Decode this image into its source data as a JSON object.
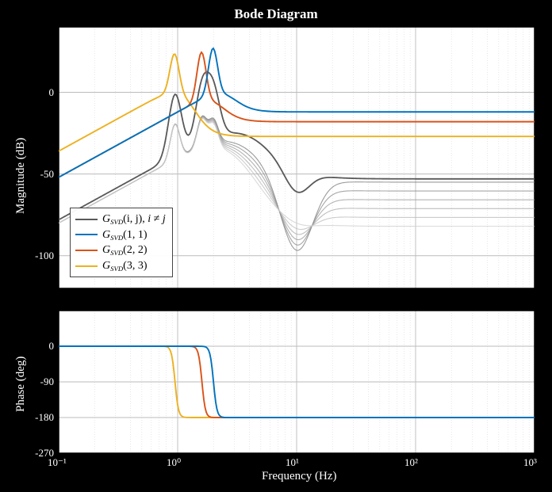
{
  "title": "Bode Diagram",
  "xlabel": "Frequency (Hz)",
  "ylabel_top": "Magnitude (dB)",
  "ylabel_bot": "Phase (deg)",
  "legend": {
    "items": [
      {
        "label_html": "G<sub>SVD</sub>(i, j), i ≠ j",
        "color": "#595959"
      },
      {
        "label_html": "G<sub>SVD</sub>(1, 1)",
        "color": "#0072BD"
      },
      {
        "label_html": "G<sub>SVD</sub>(2, 2)",
        "color": "#D95319"
      },
      {
        "label_html": "G<sub>SVD</sub>(3, 3)",
        "color": "#EDB120"
      }
    ]
  },
  "mag": {
    "ylim": [
      -120,
      40
    ],
    "yticks": [
      {
        "v": 0,
        "label": "0"
      },
      {
        "v": -50,
        "label": "-50"
      },
      {
        "v": -100,
        "label": "-100"
      }
    ]
  },
  "phase": {
    "ylim": [
      -270,
      90
    ],
    "yticks": [
      {
        "v": 0,
        "label": "0"
      },
      {
        "v": -90,
        "label": "-90"
      },
      {
        "v": -180,
        "label": "-180"
      },
      {
        "v": -270,
        "label": "-270"
      }
    ]
  },
  "freq": {
    "log_lo": -1,
    "log_hi": 3,
    "xticks": [
      {
        "exp": -1,
        "label": "10⁻¹"
      },
      {
        "exp": 0,
        "label": "10⁰"
      },
      {
        "exp": 1,
        "label": "10¹"
      },
      {
        "exp": 2,
        "label": "10²"
      },
      {
        "exp": 3,
        "label": "10³"
      }
    ]
  },
  "chart_data": [
    {
      "type": "line",
      "title": "Magnitude (dB)",
      "x_is_log": true,
      "ylim": [
        -120,
        40
      ],
      "x_freq_hz_sample": [
        0.1,
        0.2,
        0.4,
        0.6,
        0.8,
        1,
        1.2,
        1.5,
        2,
        3,
        5,
        10,
        100,
        1000
      ],
      "series": [
        {
          "name": "G_SVD(1,1)",
          "color": "#0072BD",
          "values": [
            -52,
            -45,
            -36,
            -28,
            -20,
            -12,
            -6,
            2,
            25,
            -4,
            -10,
            -12,
            -12,
            -12
          ],
          "resonance_hz": 2.0,
          "peak_db": 32,
          "plateau_db": -12
        },
        {
          "name": "G_SVD(2,2)",
          "color": "#D95319",
          "values": [
            -52,
            -44,
            -34,
            -26,
            -18,
            -8,
            2,
            22,
            -6,
            -14,
            -17,
            -18,
            -18,
            -18
          ],
          "resonance_hz": 1.6,
          "peak_db": 30,
          "plateau_db": -18
        },
        {
          "name": "G_SVD(3,3)",
          "color": "#EDB120",
          "values": [
            -36,
            -30,
            -22,
            -14,
            2,
            28,
            -10,
            -20,
            -24,
            -26,
            -27,
            -27,
            -27,
            -27
          ],
          "resonance_hz": 0.95,
          "peak_db": 30,
          "plateau_db": -27
        },
        {
          "name": "G_SVD(i,j) dominant",
          "color": "#595959",
          "values": [
            -78,
            -70,
            -60,
            -48,
            -18,
            -42,
            -32,
            -22,
            22,
            -40,
            -50,
            -52,
            -53,
            -53
          ],
          "notch_hz": 10,
          "notch_db": -62,
          "plateau_db": -53
        }
      ],
      "background_offdiag": {
        "count": 6,
        "colors": [
          "#7a7a7a",
          "#8a8a8a",
          "#9a9a9a",
          "#aaaaaa",
          "#bbbbbb",
          "#cccccc"
        ],
        "plateau_db_range": [
          -55,
          -82
        ],
        "notch_hz": 10,
        "notch_depth_db": -100,
        "lowfreq_start_db": -80,
        "resonance_peaks_hz": [
          0.95,
          1.6,
          2.0
        ]
      }
    },
    {
      "type": "line",
      "title": "Phase (deg)",
      "x_is_log": true,
      "ylim": [
        -270,
        90
      ],
      "x_freq_hz_sample": [
        0.1,
        0.5,
        0.8,
        0.95,
        1.1,
        1.4,
        1.6,
        1.8,
        2.0,
        2.3,
        5,
        1000
      ],
      "series": [
        {
          "name": "G_SVD(1,1)",
          "color": "#0072BD",
          "transition_hz": 2.0,
          "from_deg": 0,
          "to_deg": -180
        },
        {
          "name": "G_SVD(2,2)",
          "color": "#D95319",
          "transition_hz": 1.6,
          "from_deg": 0,
          "to_deg": -180
        },
        {
          "name": "G_SVD(3,3)",
          "color": "#EDB120",
          "transition_hz": 0.95,
          "from_deg": 0,
          "to_deg": -180
        }
      ]
    }
  ]
}
